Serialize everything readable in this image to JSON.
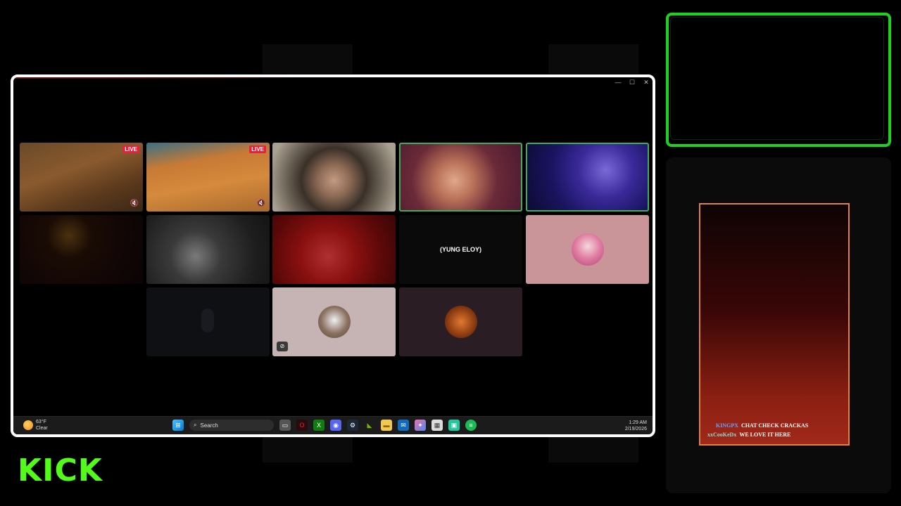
{
  "window": {
    "minimize_icon": "minimize-icon",
    "maximize_icon": "maximize-icon",
    "close_icon": "close-icon"
  },
  "tiles": {
    "t1": {
      "badge": "LIVE",
      "icon": "speaker-mute-icon"
    },
    "t2": {
      "badge": "LIVE",
      "icon": "speaker-mute-icon"
    },
    "t9": {
      "name": "(YUNG ELOY)"
    },
    "t12": {
      "icon": "camera-off-icon"
    }
  },
  "taskbar": {
    "weather_temp": "63°F",
    "weather_cond": "Clear",
    "search_label": "Search",
    "time": "1:29 AM",
    "date": "2/19/2026"
  },
  "chat": {
    "messages": [
      {
        "user": "KINGPX",
        "text": "CHAT CHECK CRACKAS"
      },
      {
        "user": "xxCooKeDx",
        "text": "WE LOVE IT HERE"
      }
    ]
  },
  "brand": {
    "logo": "KICK",
    "color": "#53fc18"
  }
}
